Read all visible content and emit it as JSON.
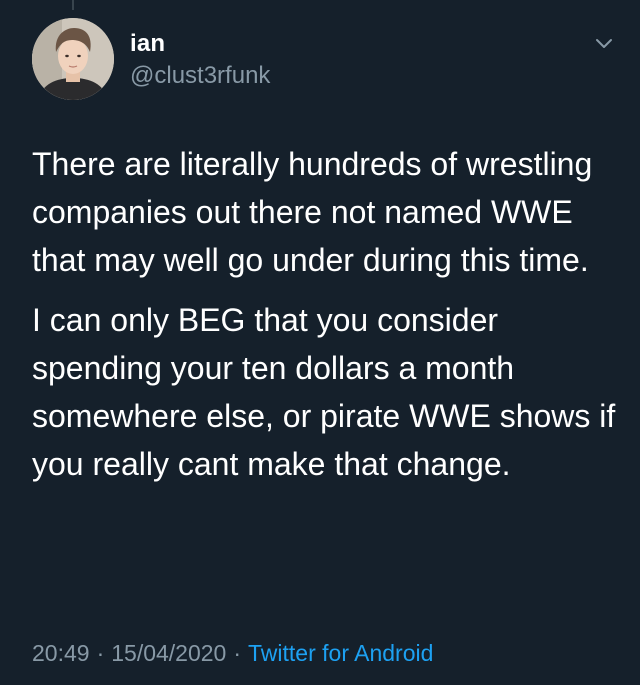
{
  "author": {
    "display_name": "ian",
    "handle": "@clust3rfunk"
  },
  "tweet": {
    "paragraphs": [
      "There are literally hundreds of wrestling companies out there not named WWE that may well go under during this time.",
      "I can only BEG that you consider spending your ten dollars a month somewhere else, or pirate WWE shows if you really cant make that change."
    ]
  },
  "meta": {
    "time": "20:49",
    "separator": "·",
    "date": "15/04/2020",
    "source": "Twitter for Android"
  },
  "icons": {
    "menu": "chevron-down-icon"
  },
  "colors": {
    "background": "#15202b",
    "text": "#ffffff",
    "secondary_text": "#8899a6",
    "link": "#1da1f2"
  }
}
